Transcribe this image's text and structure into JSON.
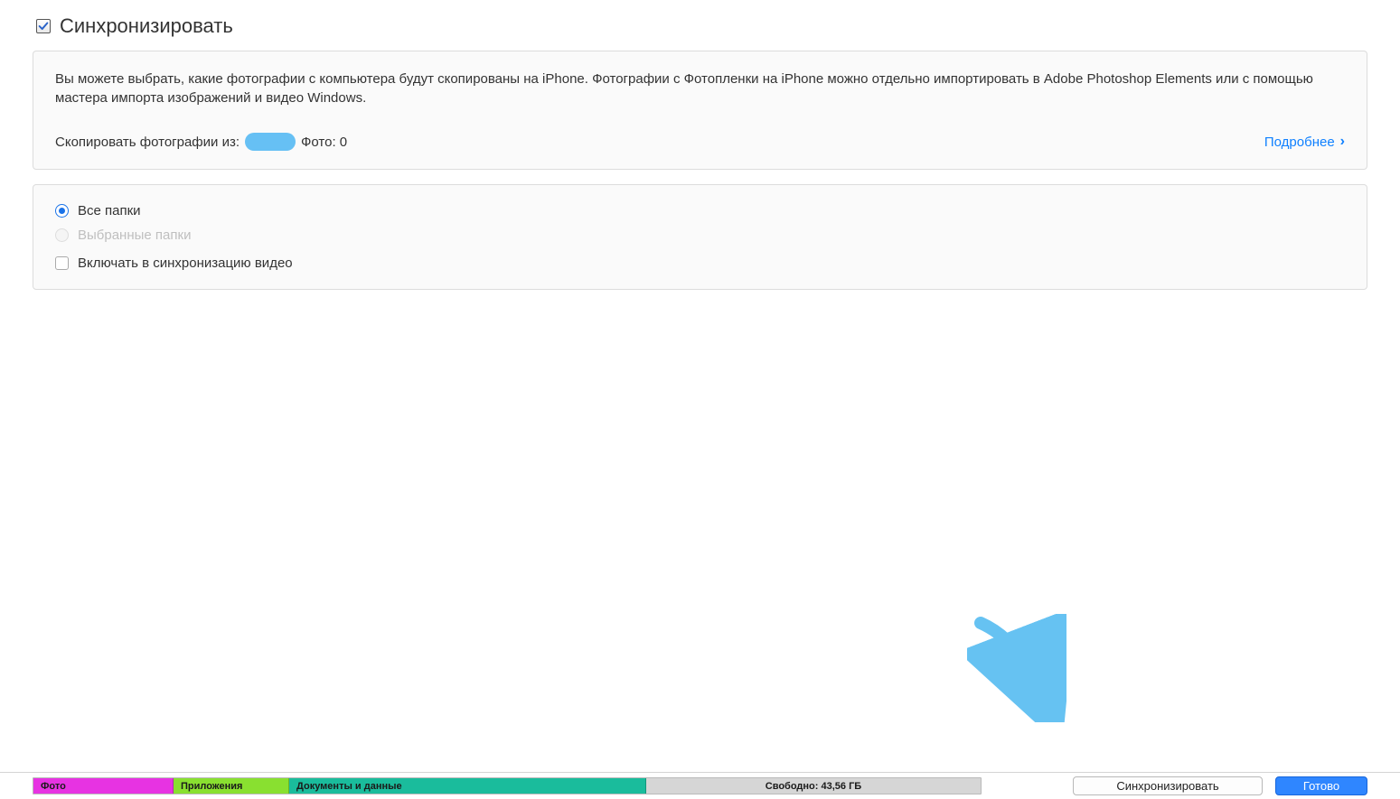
{
  "header": {
    "title": "Синхронизировать",
    "checked": true
  },
  "info_panel": {
    "description": "Вы можете выбрать, какие фотографии с компьютера будут скопированы на iPhone. Фотографии с Фотопленки на iPhone можно отдельно импортировать в Adobe Photoshop Elements или с помощью мастера импорта изображений и видео Windows.",
    "copy_from_label": "Скопировать фотографии из:",
    "photo_count_label": "Фото: 0",
    "learn_more": "Подробнее"
  },
  "options": {
    "all_folders": "Все папки",
    "selected_folders": "Выбранные папки",
    "include_video": "Включать в синхронизацию видео"
  },
  "storage": {
    "segments": {
      "photo": "Фото",
      "apps": "Приложения",
      "docs": "Документы и данные",
      "free": "Свободно: 43,56 ГБ"
    }
  },
  "footer": {
    "sync_button": "Синхронизировать",
    "done_button": "Готово"
  }
}
